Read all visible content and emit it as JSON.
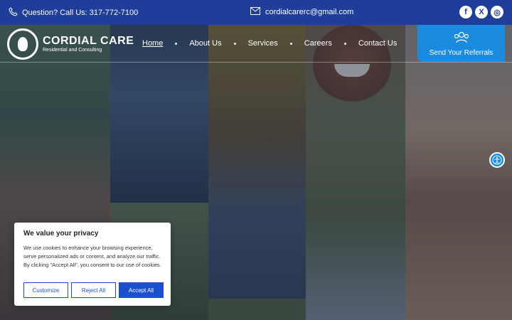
{
  "topbar": {
    "phone_text": "Question? Call Us: 317-772-7100",
    "email": "cordialcarerc@gmail.com",
    "social": [
      {
        "icon": "facebook-icon",
        "label": "f"
      },
      {
        "icon": "x-icon",
        "label": "X"
      },
      {
        "icon": "instagram-icon",
        "label": "◎"
      }
    ]
  },
  "logo": {
    "name": "CORDIAL CARE",
    "tagline": "Residential and Consulting"
  },
  "nav": {
    "items": [
      {
        "label": "Home",
        "active": true
      },
      {
        "label": "About Us"
      },
      {
        "label": "Services"
      },
      {
        "label": "Careers"
      },
      {
        "label": "Contact Us"
      }
    ]
  },
  "referral": {
    "label": "Send Your Referrals"
  },
  "cookie": {
    "title": "We value your privacy",
    "body": "We use cookies to enhance your browsing experience, serve personalized ads or content, and analyze our traffic. By clicking \"Accept All\", you consent to our use of cookies.",
    "customize": "Customize",
    "reject": "Reject All",
    "accept": "Accept All"
  },
  "colors": {
    "topbar": "#1f3d9a",
    "accent": "#1b8be0",
    "button": "#1b4fcf"
  }
}
